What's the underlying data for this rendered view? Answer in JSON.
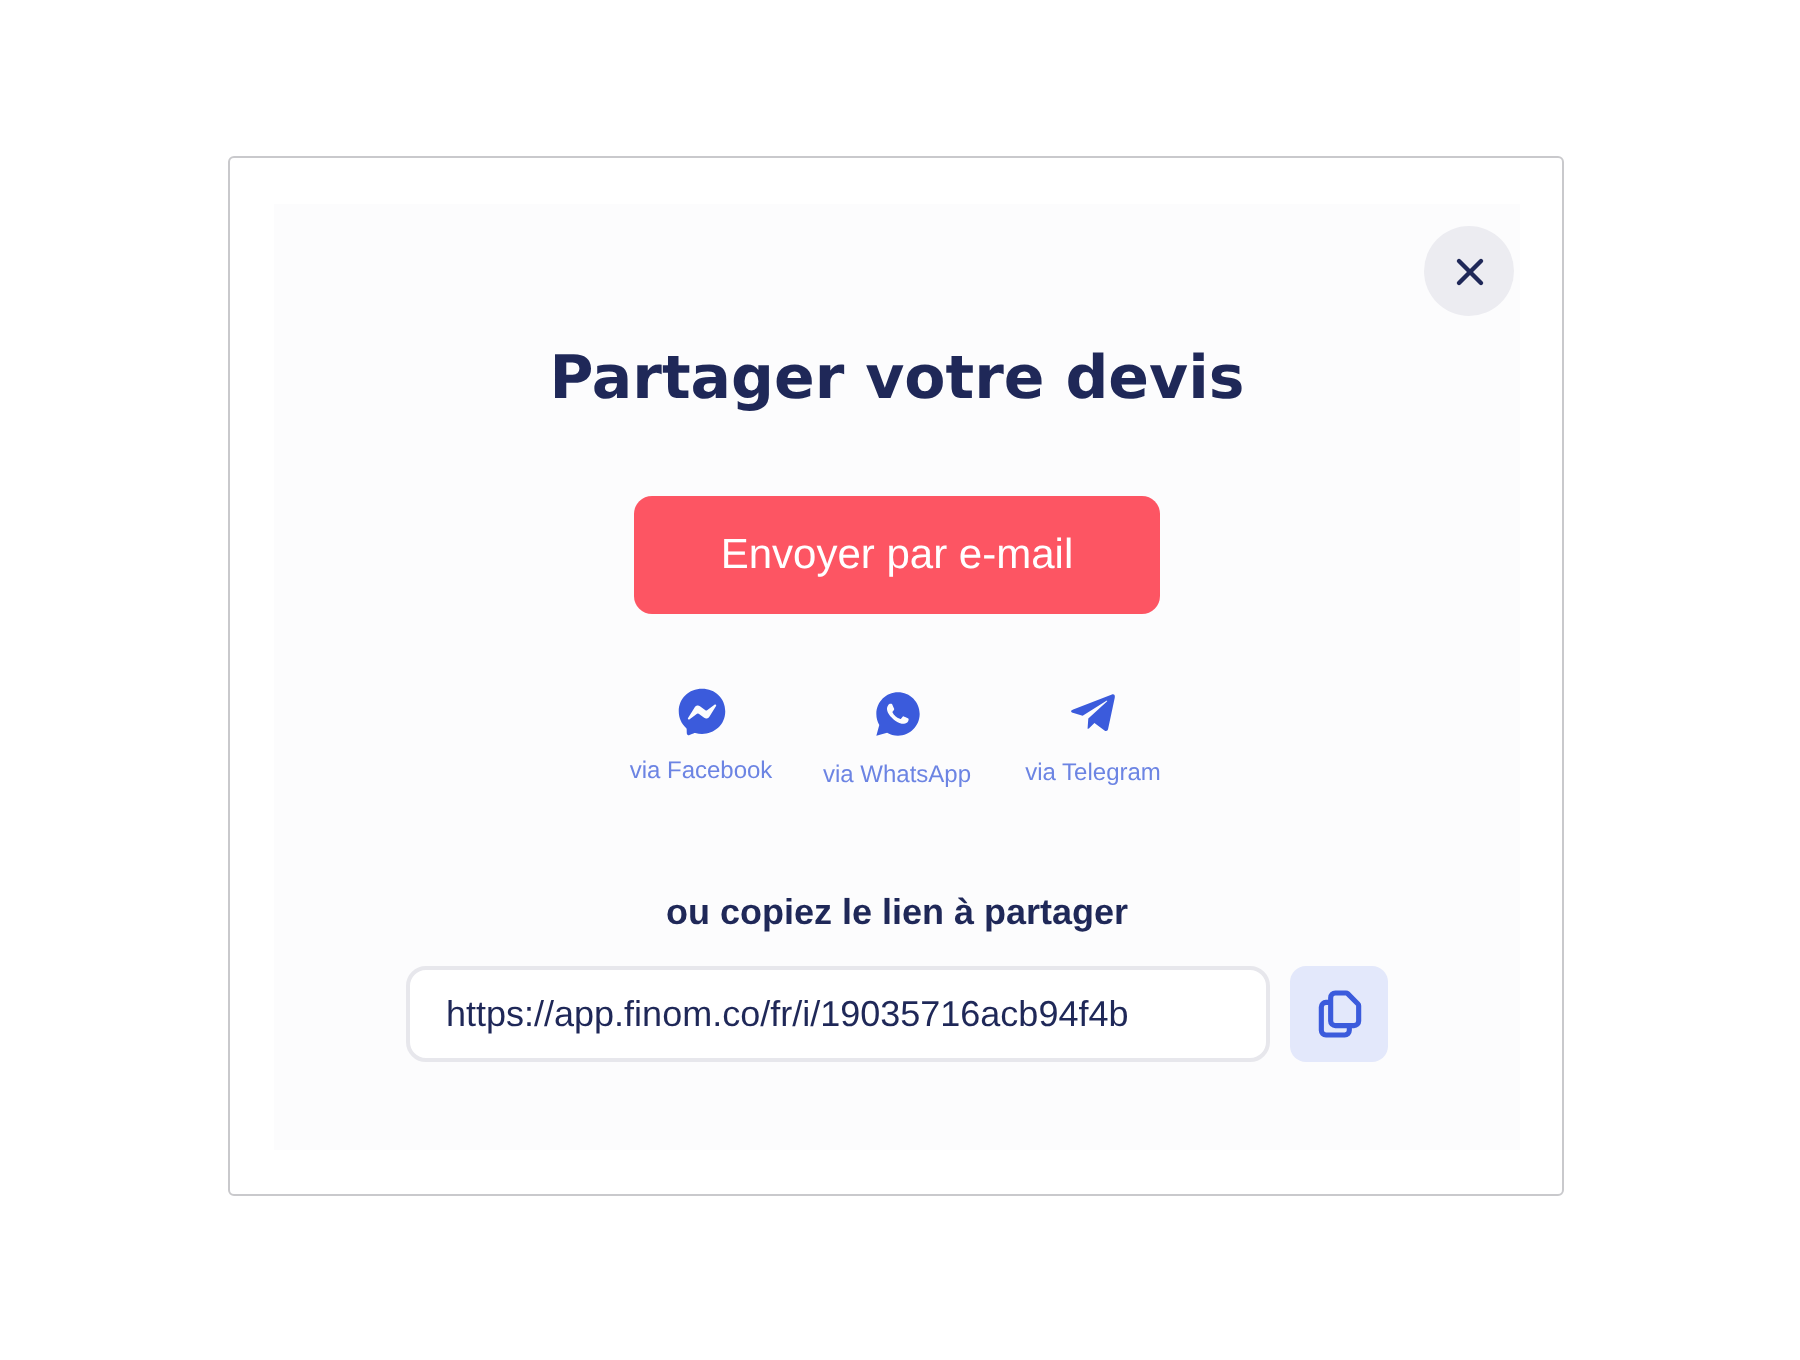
{
  "dialog": {
    "title": "Partager votre devis"
  },
  "email_button": {
    "label": "Envoyer par e-mail"
  },
  "share_options": [
    {
      "kind": "messenger",
      "label": "via Facebook"
    },
    {
      "kind": "whatsapp",
      "label": "via WhatsApp"
    },
    {
      "kind": "telegram",
      "label": "via Telegram"
    }
  ],
  "copy_link": {
    "label": "ou copiez le lien à partager",
    "value": "https://app.finom.co/fr/i/19035716acb94f4b"
  }
}
